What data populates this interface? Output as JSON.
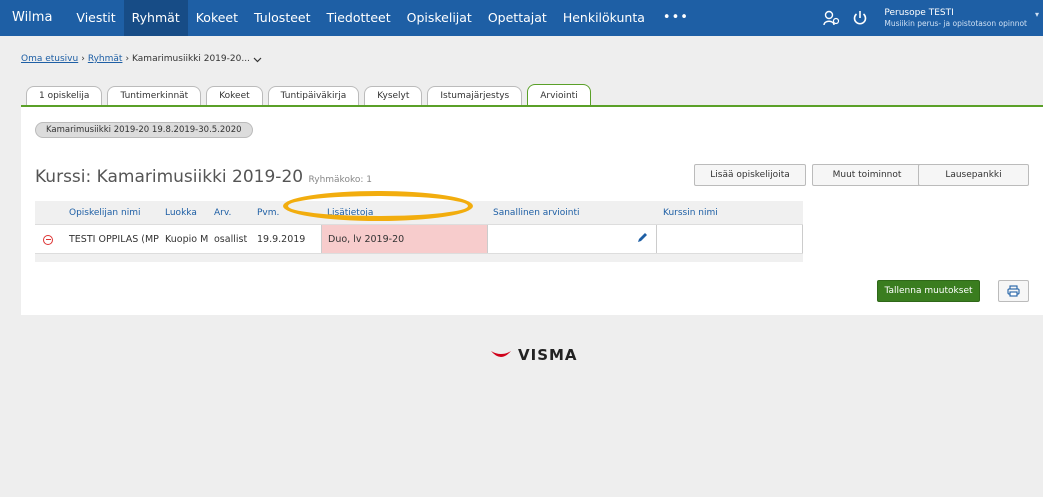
{
  "app": {
    "title": "Wilma"
  },
  "nav": {
    "items": [
      {
        "label": "Viestit"
      },
      {
        "label": "Ryhmät",
        "active": true
      },
      {
        "label": "Kokeet"
      },
      {
        "label": "Tulosteet"
      },
      {
        "label": "Tiedotteet"
      },
      {
        "label": "Opiskelijat"
      },
      {
        "label": "Opettajat"
      },
      {
        "label": "Henkilökunta"
      }
    ],
    "more": "•••"
  },
  "user": {
    "name": "Perusope TESTI",
    "org": "Musiikin perus- ja opistotason opinnot"
  },
  "breadcrumb": {
    "home": "Oma etusivu",
    "sep": "›",
    "groups": "Ryhmät",
    "current": "Kamarimusiikki 2019-20..."
  },
  "tabs": [
    {
      "label": "1 opiskelija"
    },
    {
      "label": "Tuntimerkinnät"
    },
    {
      "label": "Kokeet"
    },
    {
      "label": "Tuntipäiväkirja"
    },
    {
      "label": "Kyselyt"
    },
    {
      "label": "Istumajärjestys"
    },
    {
      "label": "Arviointi",
      "active": true
    }
  ],
  "period": "Kamarimusiikki 2019-20 19.8.2019-30.5.2020",
  "course": {
    "title": "Kurssi: Kamarimusiikki 2019-20",
    "size_label": "Ryhmäkoko: 1"
  },
  "buttons": {
    "add_students": "Lisää opiskelijoita",
    "other_actions": "Muut toiminnot",
    "phrase_bank": "Lausepankki",
    "save": "Tallenna muutokset"
  },
  "table": {
    "headers": [
      "",
      "Opiskelijan nimi",
      "Luokka",
      "Arv.",
      "Pvm.",
      "Lisätietoja",
      "Sanallinen arviointi",
      "Kurssin nimi"
    ],
    "rows": [
      {
        "name": "TESTI OPPILAS (MP)",
        "class": "Kuopio M",
        "grade": "osallist",
        "date": "19.9.2019",
        "info": "Duo, lv 2019-20",
        "verbal": "",
        "course_name": ""
      }
    ]
  },
  "footer": {
    "logo": "VISMA"
  },
  "colors": {
    "nav": "#1e5fa5",
    "accent": "#5aa028",
    "save": "#3a7d1f",
    "highlight": "#f2ad0e",
    "info_cell": "#f7cccc"
  }
}
